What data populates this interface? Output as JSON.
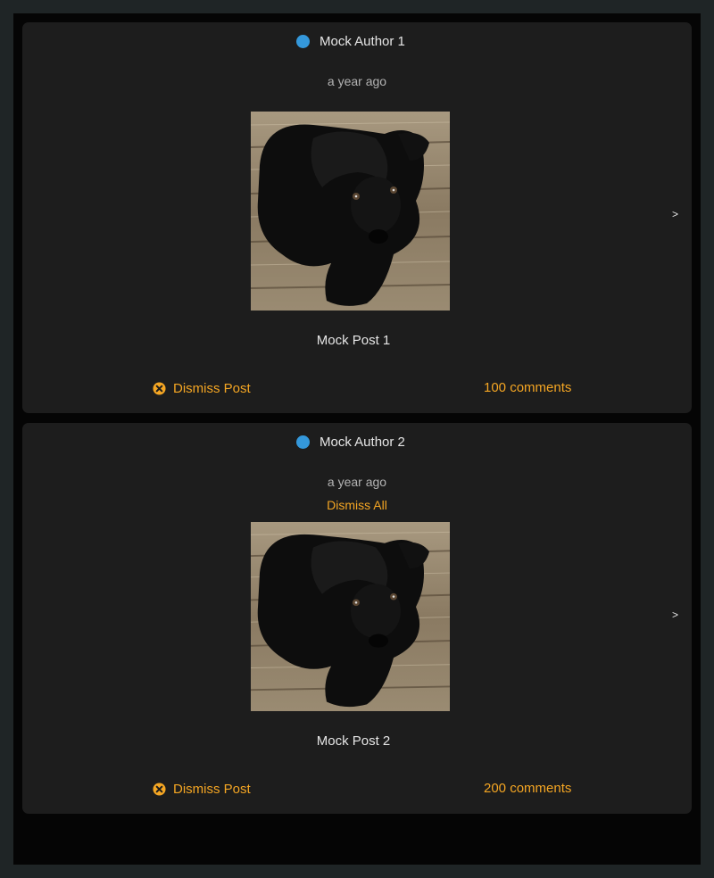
{
  "posts": [
    {
      "author": "Mock Author 1",
      "time": "a year ago",
      "dismiss_all": "",
      "title": "Mock Post 1",
      "dismiss_label": "Dismiss Post",
      "comments": "100 comments",
      "next": ">",
      "status_color": "#3498db",
      "thumbnail": "black-puppy-on-wooden-deck"
    },
    {
      "author": "Mock Author 2",
      "time": "a year ago",
      "dismiss_all": "Dismiss All",
      "title": "Mock Post 2",
      "dismiss_label": "Dismiss Post",
      "comments": "200 comments",
      "next": ">",
      "status_color": "#3498db",
      "thumbnail": "black-puppy-on-wooden-deck"
    }
  ],
  "colors": {
    "background": "#1f2526",
    "panel": "#050505",
    "card": "#1d1d1d",
    "accent": "#f5a623",
    "author_dot": "#3498db"
  }
}
